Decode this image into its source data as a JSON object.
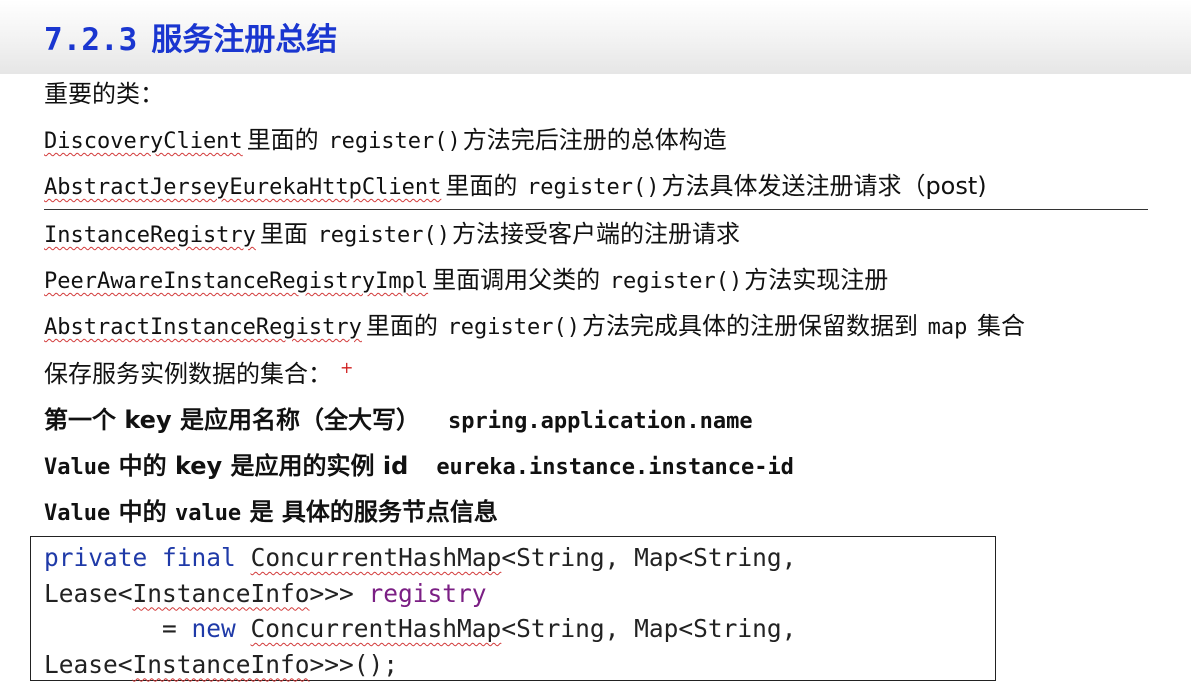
{
  "slide": {
    "title_number": "7.2.3",
    "title_text": "服务注册总结",
    "important_classes_label": "重要的类：",
    "class_lines": [
      {
        "cls": "DiscoveryClient",
        "pre": "里面的",
        "method": "register()",
        "post": "方法完后注册的总体构造"
      },
      {
        "cls": "AbstractJerseyEurekaHttpClient",
        "pre": "里面的",
        "method": "register()",
        "post": "方法具体发送注册请求（post)"
      },
      {
        "cls": "InstanceRegistry",
        "pre": "里面",
        "method": "register()",
        "post": "方法接受客户端的注册请求"
      },
      {
        "cls": "PeerAwareInstanceRegistryImpl",
        "pre": "里面调用父类的",
        "method": "register()",
        "post": "方法实现注册"
      },
      {
        "cls": "AbstractInstanceRegistry",
        "pre": "里面的",
        "method": "register()",
        "post": "方法完成具体的注册保留数据到",
        "tail_code": "map",
        "tail_text": "集合"
      }
    ],
    "collection_label": "保存服务实例数据的集合：",
    "plus_mark": "+",
    "key_line_1": {
      "text": "第一个 key 是应用名称（全大写）",
      "code": "spring.application.name"
    },
    "key_line_2": {
      "lead": "Value",
      "text": "中的 key 是应用的实例 id",
      "code": "eureka.instance.instance-id"
    },
    "key_line_3": {
      "lead": "Value",
      "text1": "中的",
      "code": "value",
      "text2": "是 具体的服务节点信息"
    }
  },
  "code": {
    "kw_private": "private",
    "kw_final": "final",
    "type_chm": "ConcurrentHashMap",
    "generic_1": "<String, Map<String,",
    "lease": "Lease<",
    "instance_info": "InstanceInfo",
    "close_1": ">>> ",
    "field_name": "registry",
    "assign": "        = ",
    "kw_new": "new",
    "generic_2": "<String, Map<String,",
    "close_2": ">>>();"
  },
  "colors": {
    "title": "#1a36d0",
    "keyword": "#1f3aa8",
    "field": "#7b1f84",
    "squiggle": "#d23a3a",
    "plus": "#d02020"
  }
}
